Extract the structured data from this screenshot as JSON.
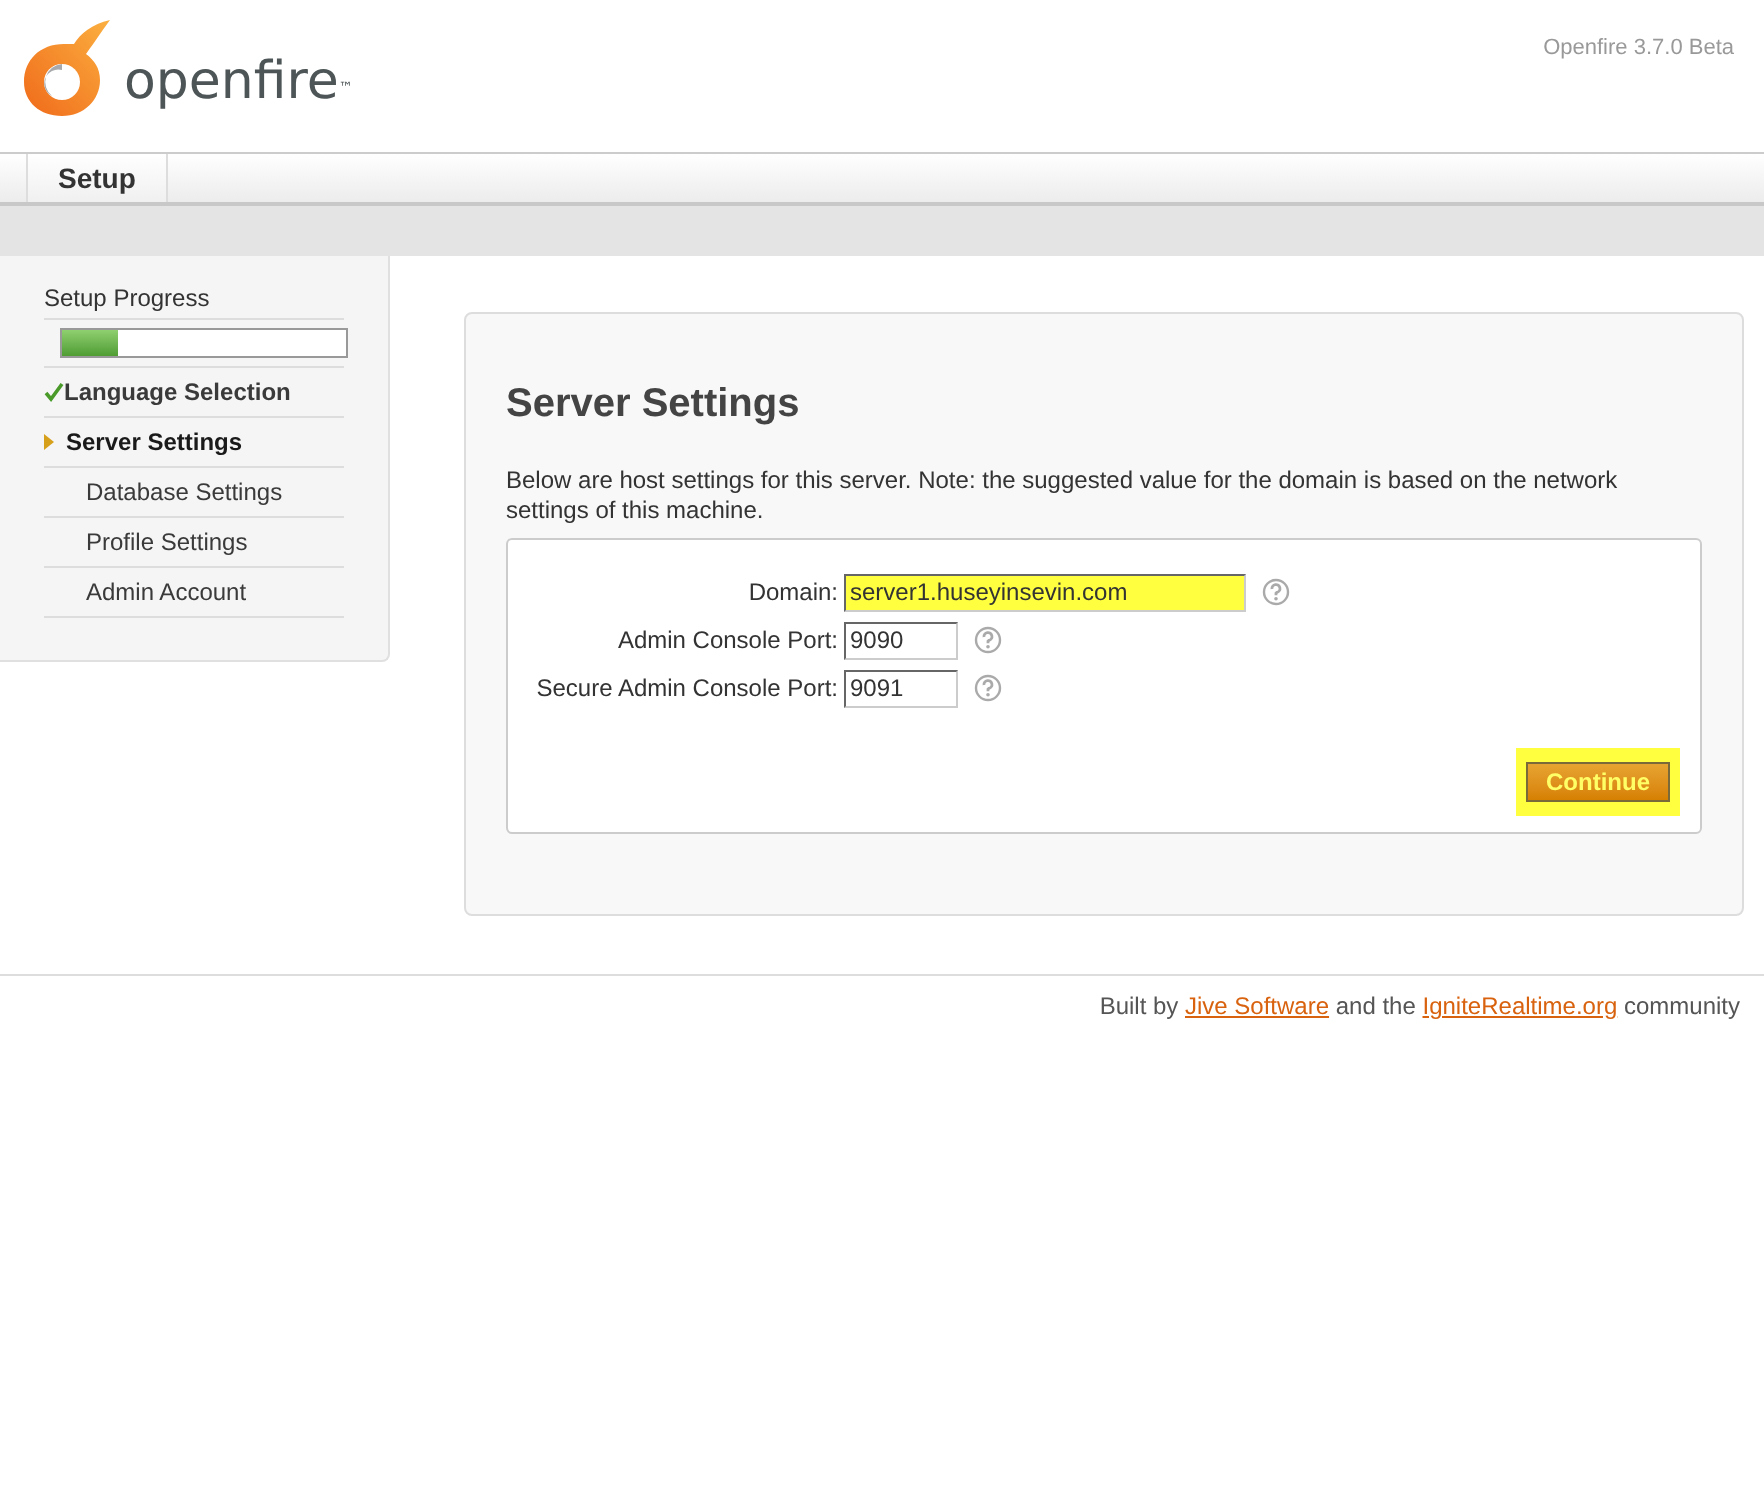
{
  "header": {
    "logo_text": "openfire",
    "trademark": "™",
    "version": "Openfire 3.7.0 Beta"
  },
  "tabs": [
    {
      "label": "Setup",
      "selected": true
    }
  ],
  "sidebar": {
    "title": "Setup Progress",
    "progress": {
      "level": 0.2
    },
    "steps": [
      {
        "kind": "done",
        "label": "Language Selection",
        "selected": false
      },
      {
        "kind": "current",
        "label": "Server Settings",
        "selected": true
      },
      {
        "kind": "pending",
        "label": "Database Settings",
        "selected": false
      },
      {
        "kind": "pending",
        "label": "Profile Settings",
        "selected": false
      },
      {
        "kind": "pending",
        "label": "Admin Account",
        "selected": false
      }
    ]
  },
  "main": {
    "title": "Server Settings",
    "description": "Below are host settings for this server. Note: the suggested value for the domain is based on the network settings of this machine.",
    "fields": [
      {
        "label": "Domain:",
        "value": "server1.huseyinsevin.com",
        "highlighted": true,
        "wide": true
      },
      {
        "label": "Admin Console Port:",
        "value": "9090",
        "highlighted": false,
        "wide": false
      },
      {
        "label": "Secure Admin Console Port:",
        "value": "9091",
        "highlighted": false,
        "wide": false
      }
    ],
    "button": {
      "label": "Continue",
      "highlighted": true
    }
  },
  "footer": [
    {
      "kind": "text",
      "text": "Built by "
    },
    {
      "kind": "link",
      "text": "Jive Software"
    },
    {
      "kind": "text",
      "text": " and the "
    },
    {
      "kind": "link",
      "text": "IgniteRealtime.org"
    },
    {
      "kind": "text",
      "text": " community"
    }
  ]
}
